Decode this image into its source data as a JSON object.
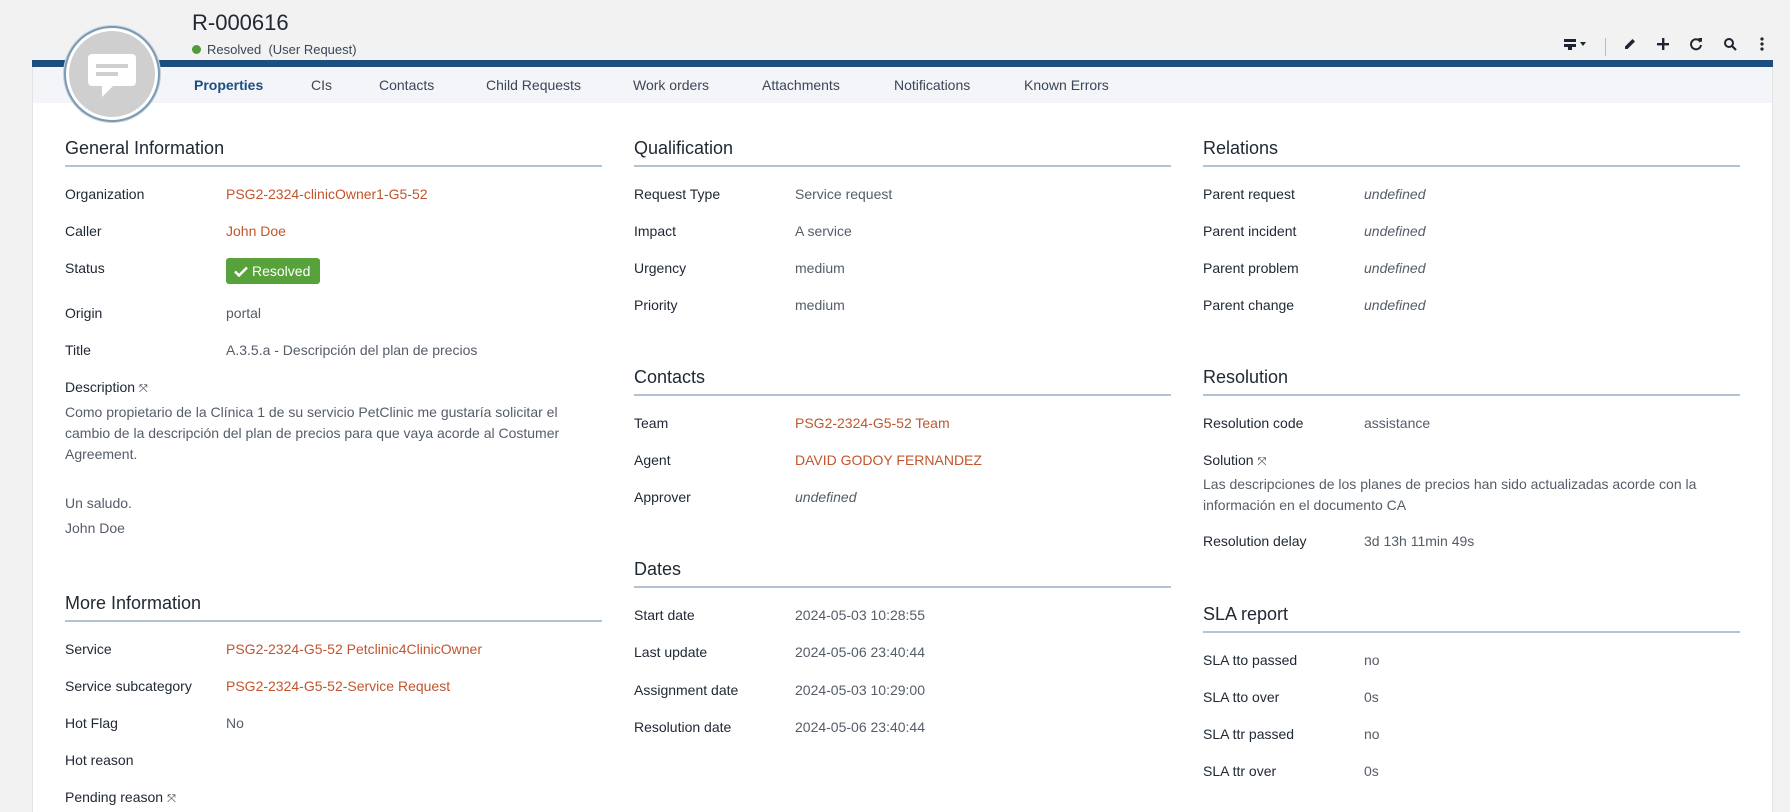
{
  "header": {
    "reference": "R-000616",
    "status_label": "Resolved",
    "status_detail": "(User Request)"
  },
  "toolbar": {
    "icons": [
      "list-menu-icon",
      "edit-icon",
      "add-icon",
      "refresh-icon",
      "search-icon",
      "more-icon"
    ]
  },
  "tabs": [
    {
      "label": "Properties"
    },
    {
      "label": "CIs"
    },
    {
      "label": "Contacts"
    },
    {
      "label": "Child Requests"
    },
    {
      "label": "Work orders"
    },
    {
      "label": "Attachments"
    },
    {
      "label": "Notifications"
    },
    {
      "label": "Known Errors"
    }
  ],
  "general": {
    "title": "General Information",
    "organization_label": "Organization",
    "organization_value": "PSG2-2324-clinicOwner1-G5-52",
    "caller_label": "Caller",
    "caller_value": "John Doe",
    "status_label": "Status",
    "status_value": "Resolved",
    "origin_label": "Origin",
    "origin_value": "portal",
    "title_label": "Title",
    "title_value": "A.3.5.a - Descripción del plan de precios",
    "description_label": "Description",
    "description_line1": "Como propietario de la Clínica 1 de su servicio PetClinic me gustaría solicitar el",
    "description_line2": "cambio de la descripción del plan de precios para que vaya acorde al Costumer",
    "description_line3": "Agreement.",
    "description_line4": "Un saludo.",
    "description_line5": "John Doe"
  },
  "more": {
    "title": "More Information",
    "service_label": "Service",
    "service_value": "PSG2-2324-G5-52 Petclinic4ClinicOwner",
    "subcategory_label": "Service subcategory",
    "subcategory_value": "PSG2-2324-G5-52-Service Request",
    "hotflag_label": "Hot Flag",
    "hotflag_value": "No",
    "hotreason_label": "Hot reason",
    "pending_label": "Pending reason"
  },
  "qualification": {
    "title": "Qualification",
    "type_label": "Request Type",
    "type_value": "Service request",
    "impact_label": "Impact",
    "impact_value": "A service",
    "urgency_label": "Urgency",
    "urgency_value": "medium",
    "priority_label": "Priority",
    "priority_value": "medium"
  },
  "contacts": {
    "title": "Contacts",
    "team_label": "Team",
    "team_value": "PSG2-2324-G5-52 Team",
    "agent_label": "Agent",
    "agent_value": "DAVID GODOY FERNANDEZ",
    "approver_label": "Approver",
    "approver_value": "undefined"
  },
  "dates": {
    "title": "Dates",
    "start_label": "Start date",
    "start_value": "2024-05-03 10:28:55",
    "update_label": "Last update",
    "update_value": "2024-05-06 23:40:44",
    "assign_label": "Assignment date",
    "assign_value": "2024-05-03 10:29:00",
    "resolution_label": "Resolution date",
    "resolution_value": "2024-05-06 23:40:44"
  },
  "relations": {
    "title": "Relations",
    "req_label": "Parent request",
    "req_value": "undefined",
    "inc_label": "Parent incident",
    "inc_value": "undefined",
    "prob_label": "Parent problem",
    "prob_value": "undefined",
    "chg_label": "Parent change",
    "chg_value": "undefined"
  },
  "resolution": {
    "title": "Resolution",
    "code_label": "Resolution code",
    "code_value": "assistance",
    "solution_label": "Solution",
    "solution_line1": "Las descripciones de los planes de precios han sido actualizadas acorde con la",
    "solution_line2": "información en el documento CA",
    "delay_label": "Resolution delay",
    "delay_value": "3d 13h 11min 49s"
  },
  "sla": {
    "title": "SLA report",
    "tto_passed_label": "SLA tto passed",
    "tto_passed_value": "no",
    "tto_over_label": "SLA tto over",
    "tto_over_value": "0s",
    "ttr_passed_label": "SLA ttr passed",
    "ttr_passed_value": "no",
    "ttr_over_label": "SLA ttr over",
    "ttr_over_value": "0s"
  }
}
